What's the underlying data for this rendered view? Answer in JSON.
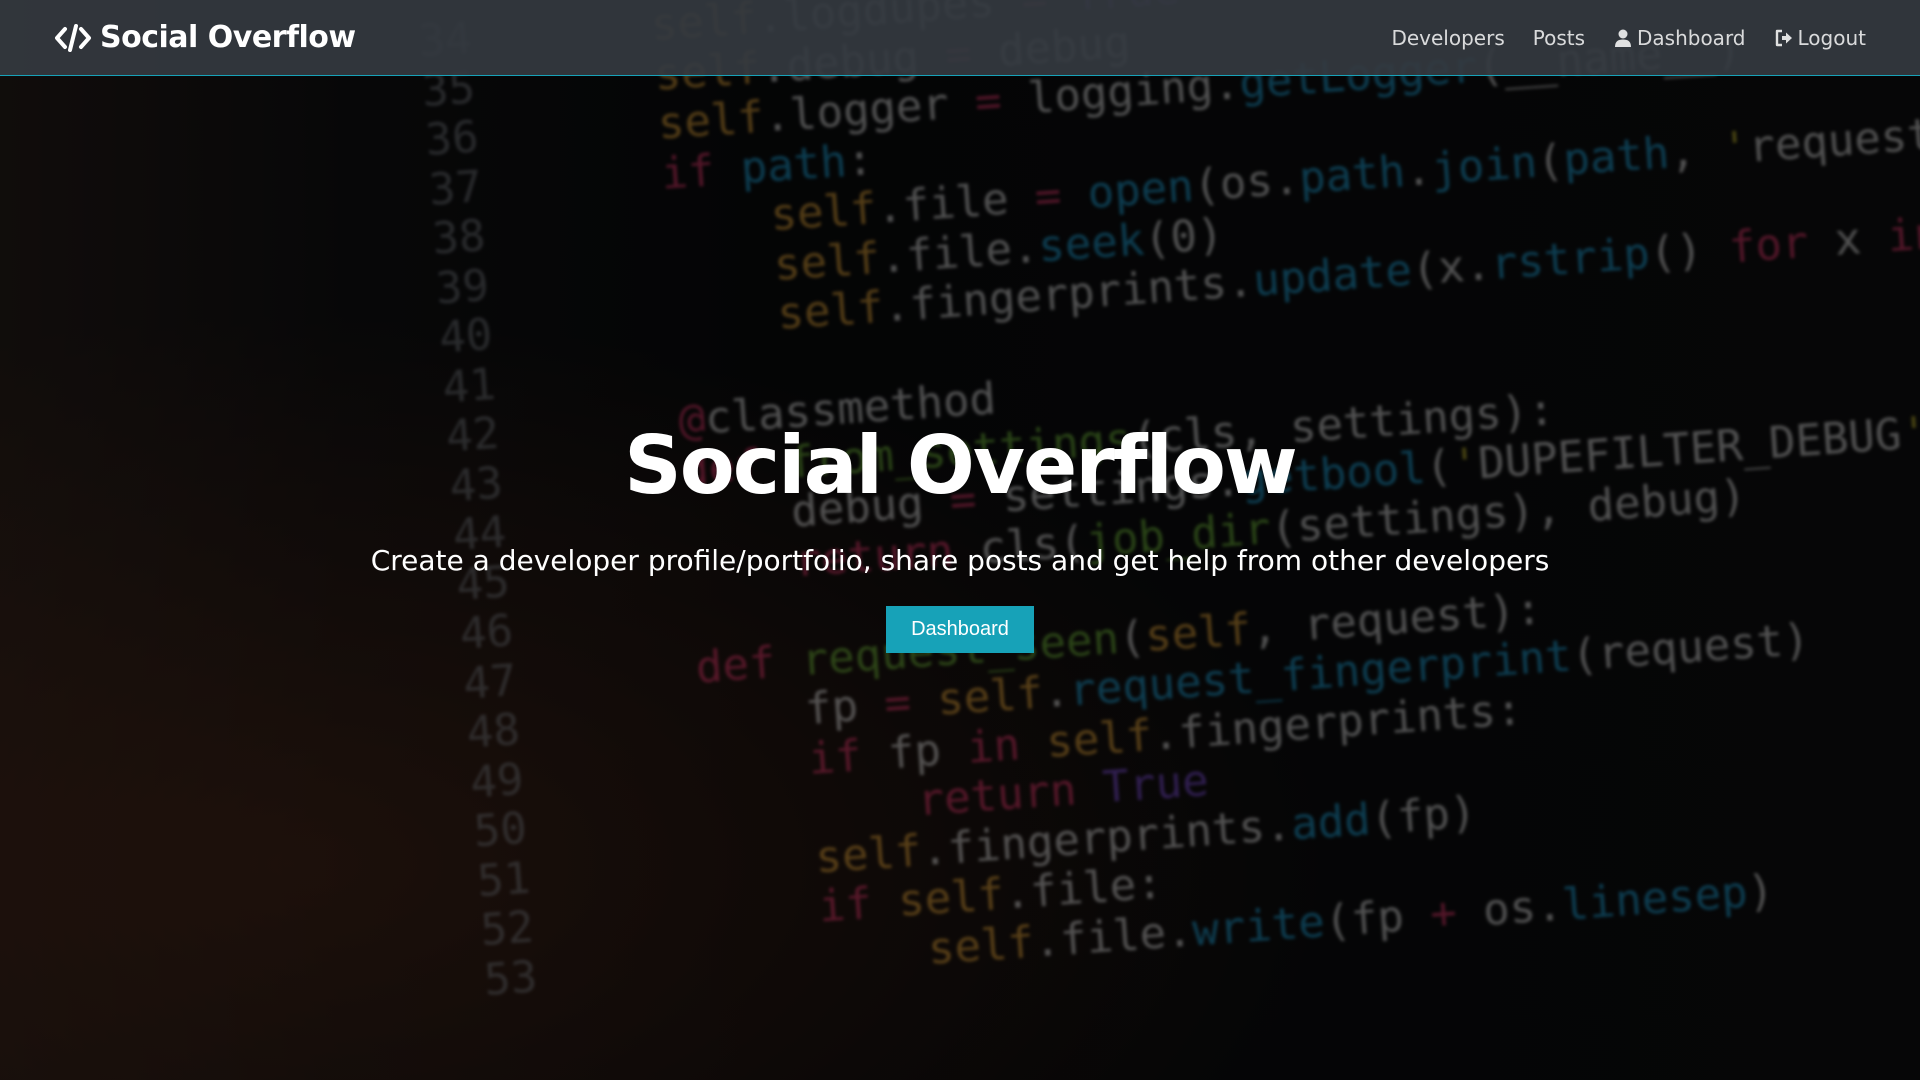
{
  "navbar": {
    "brand_label": "Social Overflow",
    "brand_icon": "code-icon",
    "links": [
      {
        "label": "Developers"
      },
      {
        "label": "Posts"
      },
      {
        "label": "Dashboard",
        "icon": "user-icon"
      },
      {
        "label": "Logout",
        "icon": "sign-out-icon"
      }
    ]
  },
  "hero": {
    "title": "Social Overflow",
    "lead": "Create a developer profile/portfolio, share posts and get help from other developers",
    "button_label": "Dashboard"
  },
  "background_code": {
    "line_numbers": [
      "34",
      "35",
      "36",
      "37",
      "38",
      "39",
      "40",
      "41",
      "42",
      "43",
      "44",
      "45",
      "46",
      "47",
      "48",
      "49",
      "50",
      "51",
      "52",
      "53"
    ],
    "lines": [
      "self.logdupes = True",
      "self.debug = debug",
      "self.logger = logging.getLogger(__name__)",
      "if path:",
      "    self.file = open(os.path.join(path, 'requests.seen'), 'a+')",
      "    self.file.seek(0)",
      "    self.fingerprints.update(x.rstrip() for x in self.file)",
      "",
      "@classmethod",
      "def from_settings(cls, settings):",
      "    debug = settings.getbool('DUPEFILTER_DEBUG')",
      "    return cls(job_dir(settings), debug)",
      "",
      "def request_seen(self, request):",
      "    fp = self.request_fingerprint(request)",
      "    if fp in self.fingerprints:",
      "        return True",
      "    self.fingerprints.add(fp)",
      "    if self.file:",
      "        self.file.write(fp + os.linesep)"
    ]
  },
  "colors": {
    "accent": "#17a2b8",
    "navbar": "#343a40"
  }
}
